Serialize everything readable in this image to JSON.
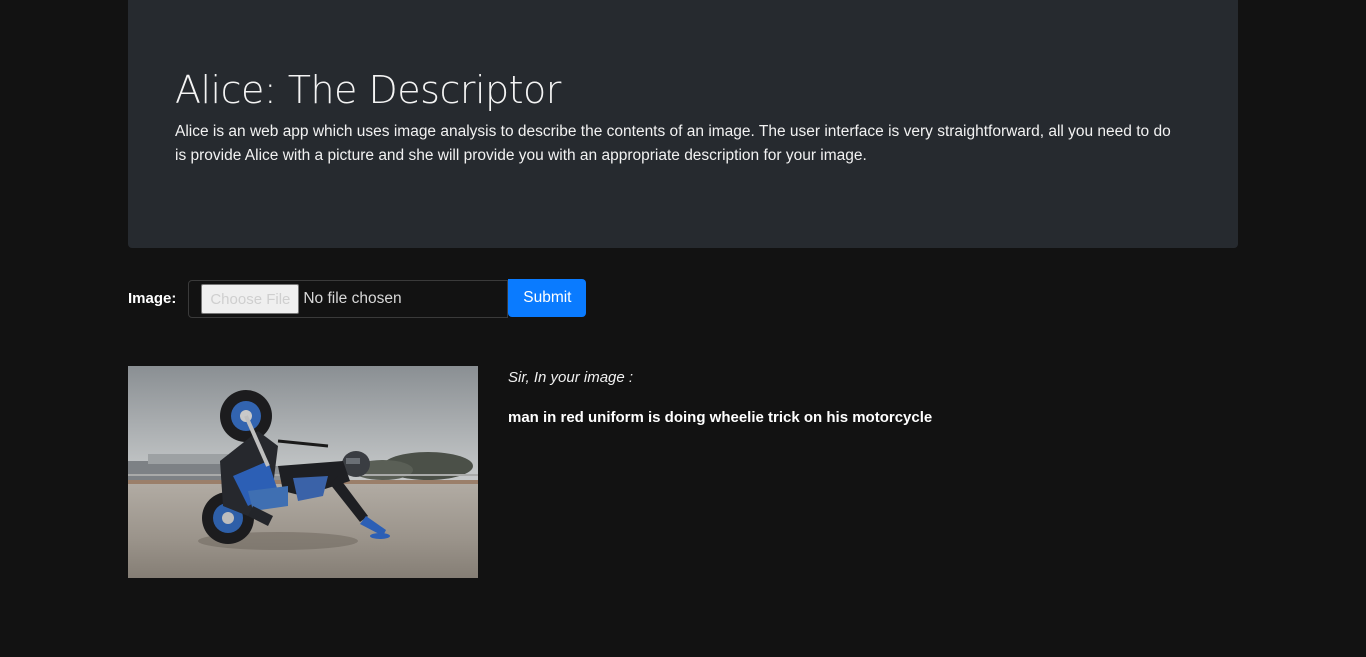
{
  "header": {
    "title": "Alice: The Descriptor",
    "description": "Alice is an web app which uses image analysis to describe the contents of an image. The user interface is very straightforward, all you need to do is provide Alice with a picture and she will provide you with an appropriate description for your image."
  },
  "upload_form": {
    "label": "Image:",
    "choose_file_label": "Choose File",
    "file_status": "No file chosen",
    "submit_label": "Submit"
  },
  "result": {
    "image_icon": "motorcycle-wheelie-photo",
    "intro": "Sir, In your image :",
    "caption": "man in red uniform is doing wheelie trick on his motorcycle"
  },
  "colors": {
    "page_background": "#121212",
    "jumbotron_background": "#262a2f",
    "submit_button": "#0a7bff"
  }
}
